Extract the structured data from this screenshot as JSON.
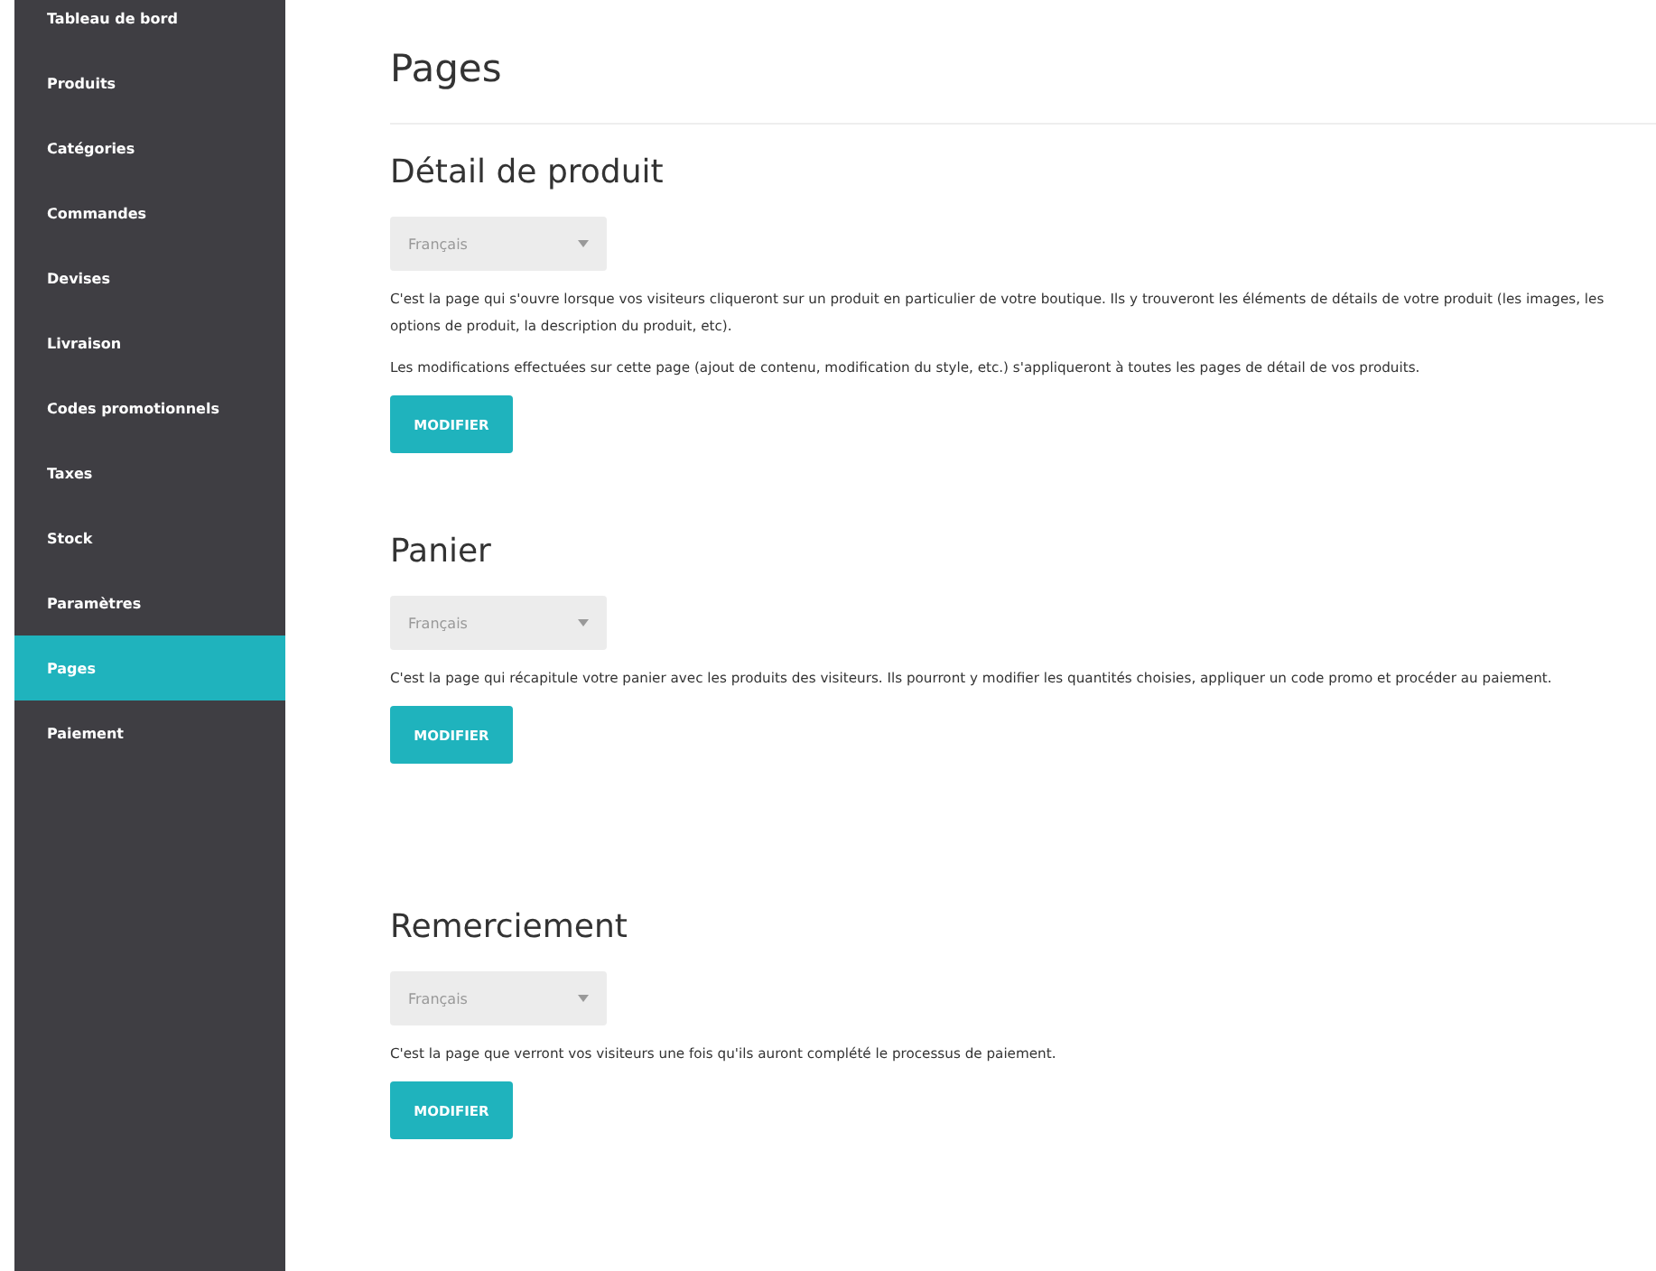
{
  "sidebar": {
    "items": [
      {
        "label": "Tableau de bord",
        "selected": false
      },
      {
        "label": "Produits",
        "selected": false
      },
      {
        "label": "Catégories",
        "selected": false
      },
      {
        "label": "Commandes",
        "selected": false
      },
      {
        "label": "Devises",
        "selected": false
      },
      {
        "label": "Livraison",
        "selected": false
      },
      {
        "label": "Codes promotionnels",
        "selected": false
      },
      {
        "label": "Taxes",
        "selected": false
      },
      {
        "label": "Stock",
        "selected": false
      },
      {
        "label": "Paramètres",
        "selected": false
      },
      {
        "label": "Pages",
        "selected": true
      },
      {
        "label": "Paiement",
        "selected": false
      }
    ]
  },
  "title": "Pages",
  "sections": [
    {
      "heading": "Détail de produit",
      "language": "Français",
      "paragraphs": [
        "C'est la page qui s'ouvre lorsque vos visiteurs cliqueront sur un produit en particulier de votre boutique. Ils y trouveront les éléments de détails de votre produit (les images, les options de produit, la description du produit, etc).",
        "Les modifications effectuées sur cette page (ajout de contenu, modification du style, etc.) s'appliqueront à toutes les pages de détail de vos produits."
      ],
      "button": "MODIFIER"
    },
    {
      "heading": "Panier",
      "language": "Français",
      "paragraphs": [
        "C'est la page qui récapitule votre panier avec les produits des visiteurs. Ils pourront y modifier les quantités choisies, appliquer un code promo et procéder au paiement."
      ],
      "button": "MODIFIER"
    },
    {
      "heading": "Remerciement",
      "language": "Français",
      "paragraphs": [
        "C'est la page que verront vos visiteurs une fois qu'ils auront complété le processus de paiement."
      ],
      "button": "MODIFIER"
    }
  ]
}
